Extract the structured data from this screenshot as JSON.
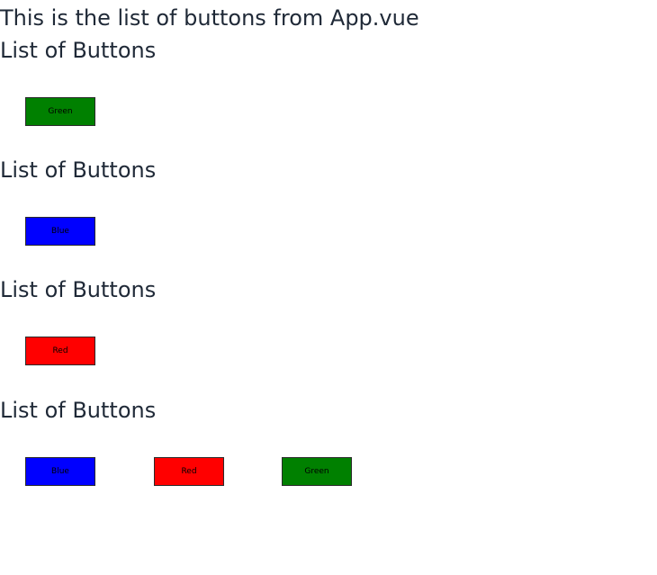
{
  "app": {
    "heading": "This is the list of buttons from App.vue"
  },
  "groups": [
    {
      "title": "List of Buttons",
      "buttons": [
        {
          "label": "Green",
          "color": "#008000"
        }
      ]
    },
    {
      "title": "List of Buttons",
      "buttons": [
        {
          "label": "Blue",
          "color": "#0000ff"
        }
      ]
    },
    {
      "title": "List of Buttons",
      "buttons": [
        {
          "label": "Red",
          "color": "#ff0000"
        }
      ]
    },
    {
      "title": "List of Buttons",
      "buttons": [
        {
          "label": "Blue",
          "color": "#0000ff"
        },
        {
          "label": "Red",
          "color": "#ff0000"
        },
        {
          "label": "Green",
          "color": "#008000"
        }
      ]
    }
  ]
}
